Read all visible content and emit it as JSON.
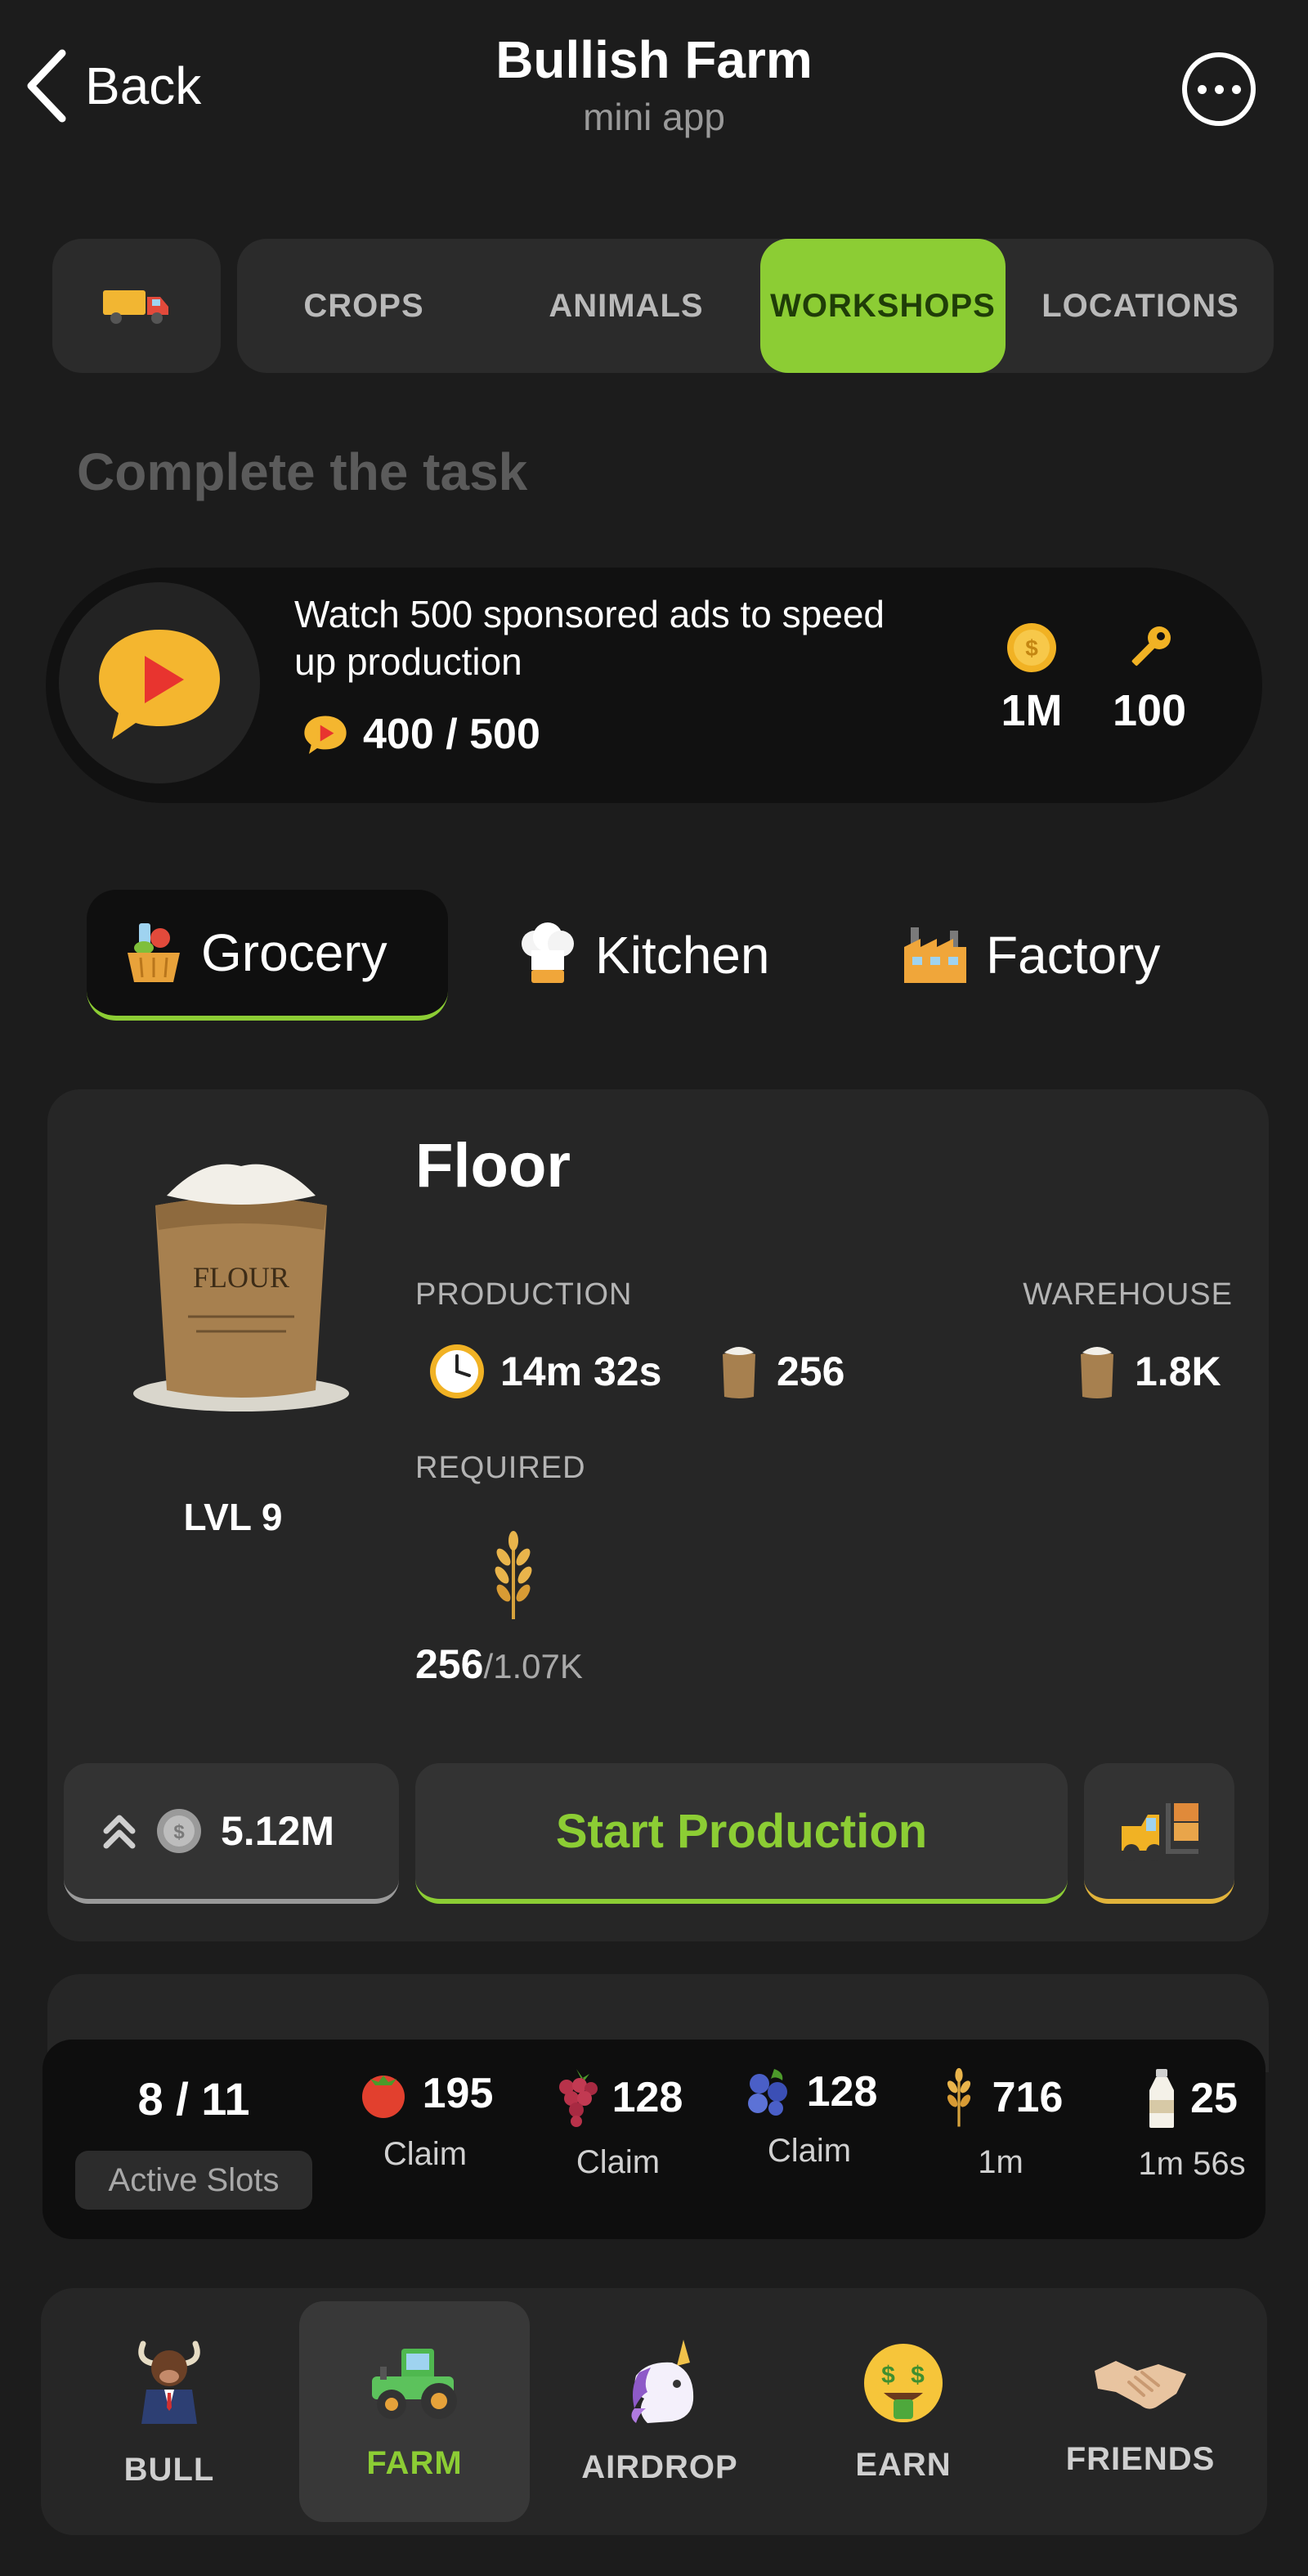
{
  "header": {
    "back_label": "Back",
    "title": "Bullish Farm",
    "subtitle": "mini app"
  },
  "tabs": [
    "CROPS",
    "ANIMALS",
    "WORKSHOPS",
    "LOCATIONS"
  ],
  "active_tab": "WORKSHOPS",
  "section_title": "Complete the task",
  "task": {
    "text": "Watch 500 sponsored ads to speed up production",
    "progress": "400 / 500",
    "progress_value": 400,
    "progress_max": 500,
    "reward_coins": "1M",
    "reward_keys": "100"
  },
  "workshop_tabs": [
    "Grocery",
    "Kitchen",
    "Factory"
  ],
  "active_workshop": "Grocery",
  "product": {
    "name": "Floor",
    "bag_text": "FLOUR",
    "level": "LVL 9",
    "production_label": "PRODUCTION",
    "warehouse_label": "WAREHOUSE",
    "time": "14m 32s",
    "output": "256",
    "warehouse": "1.8K",
    "required_label": "REQUIRED",
    "required_have": "256",
    "required_need": "/1.07K",
    "upgrade_cost": "5.12M",
    "start_label": "Start Production"
  },
  "slots": {
    "count": "8 / 11",
    "label": "Active Slots",
    "items": [
      {
        "icon": "tomato-icon",
        "value": "195",
        "status": "Claim"
      },
      {
        "icon": "grapes-icon",
        "value": "128",
        "status": "Claim"
      },
      {
        "icon": "blueberries-icon",
        "value": "128",
        "status": "Claim"
      },
      {
        "icon": "wheat-icon",
        "value": "716",
        "status": "1m"
      },
      {
        "icon": "milk-bottle-icon",
        "value": "25",
        "status": "1m 56s"
      }
    ]
  },
  "nav": [
    "BULL",
    "FARM",
    "AIRDROP",
    "EARN",
    "FRIENDS"
  ],
  "active_nav": "FARM",
  "colors": {
    "accent": "#8ccd34",
    "background": "#1c1c1c",
    "card": "#262626",
    "gold": "#e1b33b"
  }
}
